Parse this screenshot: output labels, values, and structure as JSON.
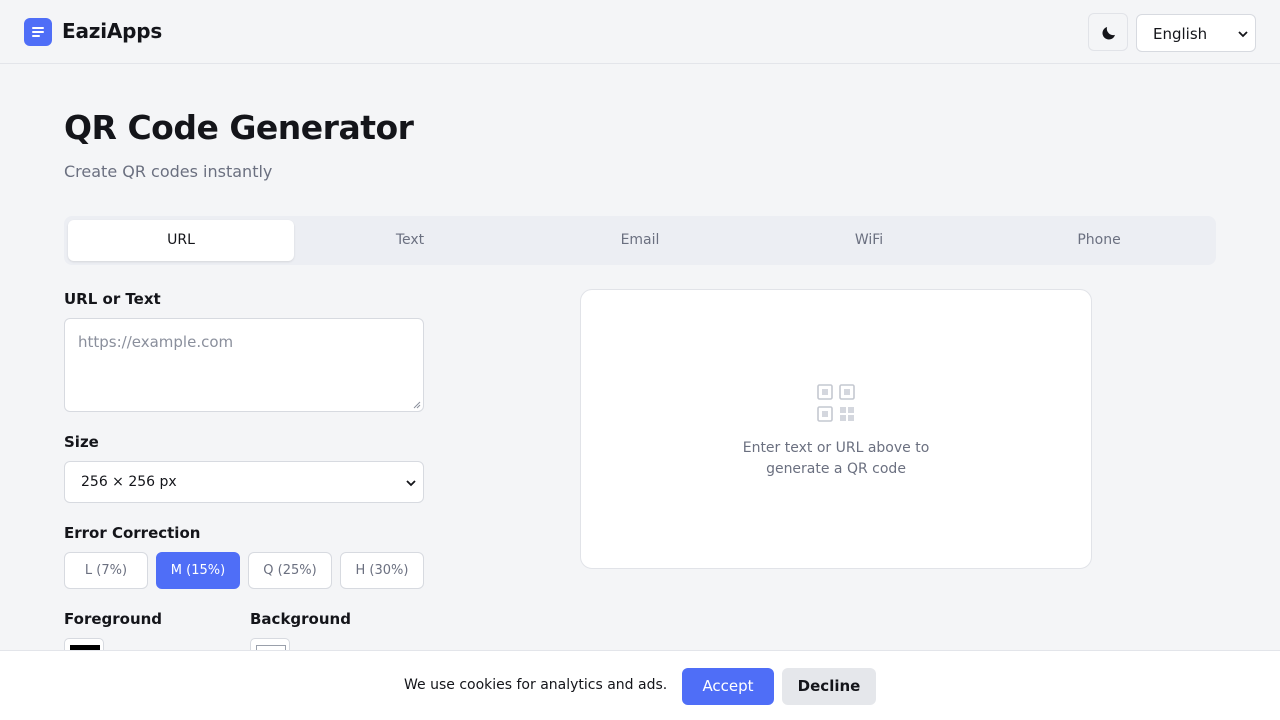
{
  "header": {
    "brand": "EaziApps",
    "language": "English",
    "icons": {
      "logo": "menu-lines-icon",
      "theme": "moon-icon"
    }
  },
  "page": {
    "title": "QR Code Generator",
    "subtitle": "Create QR codes instantly"
  },
  "tabs": [
    {
      "label": "URL",
      "active": true
    },
    {
      "label": "Text",
      "active": false
    },
    {
      "label": "Email",
      "active": false
    },
    {
      "label": "WiFi",
      "active": false
    },
    {
      "label": "Phone",
      "active": false
    }
  ],
  "form": {
    "url_label": "URL or Text",
    "url_placeholder": "https://example.com",
    "url_value": "",
    "size_label": "Size",
    "size_value": "256 × 256 px",
    "ec_label": "Error Correction",
    "ec_options": [
      {
        "label": "L (7%)",
        "active": false
      },
      {
        "label": "M (15%)",
        "active": true
      },
      {
        "label": "Q (25%)",
        "active": false
      },
      {
        "label": "H (30%)",
        "active": false
      }
    ],
    "fg_label": "Foreground",
    "bg_label": "Background",
    "fg_color": "#000000",
    "bg_color": "#ffffff"
  },
  "preview": {
    "line1": "Enter text or URL above to",
    "line2": "generate a QR code",
    "icon": "qr-code-icon"
  },
  "cookie": {
    "message": "We use cookies for analytics and ads.",
    "accept": "Accept",
    "decline": "Decline"
  },
  "colors": {
    "accent": "#4f6ef7",
    "background": "#f4f5f7",
    "text": "#14151a",
    "muted": "#6b7080"
  }
}
